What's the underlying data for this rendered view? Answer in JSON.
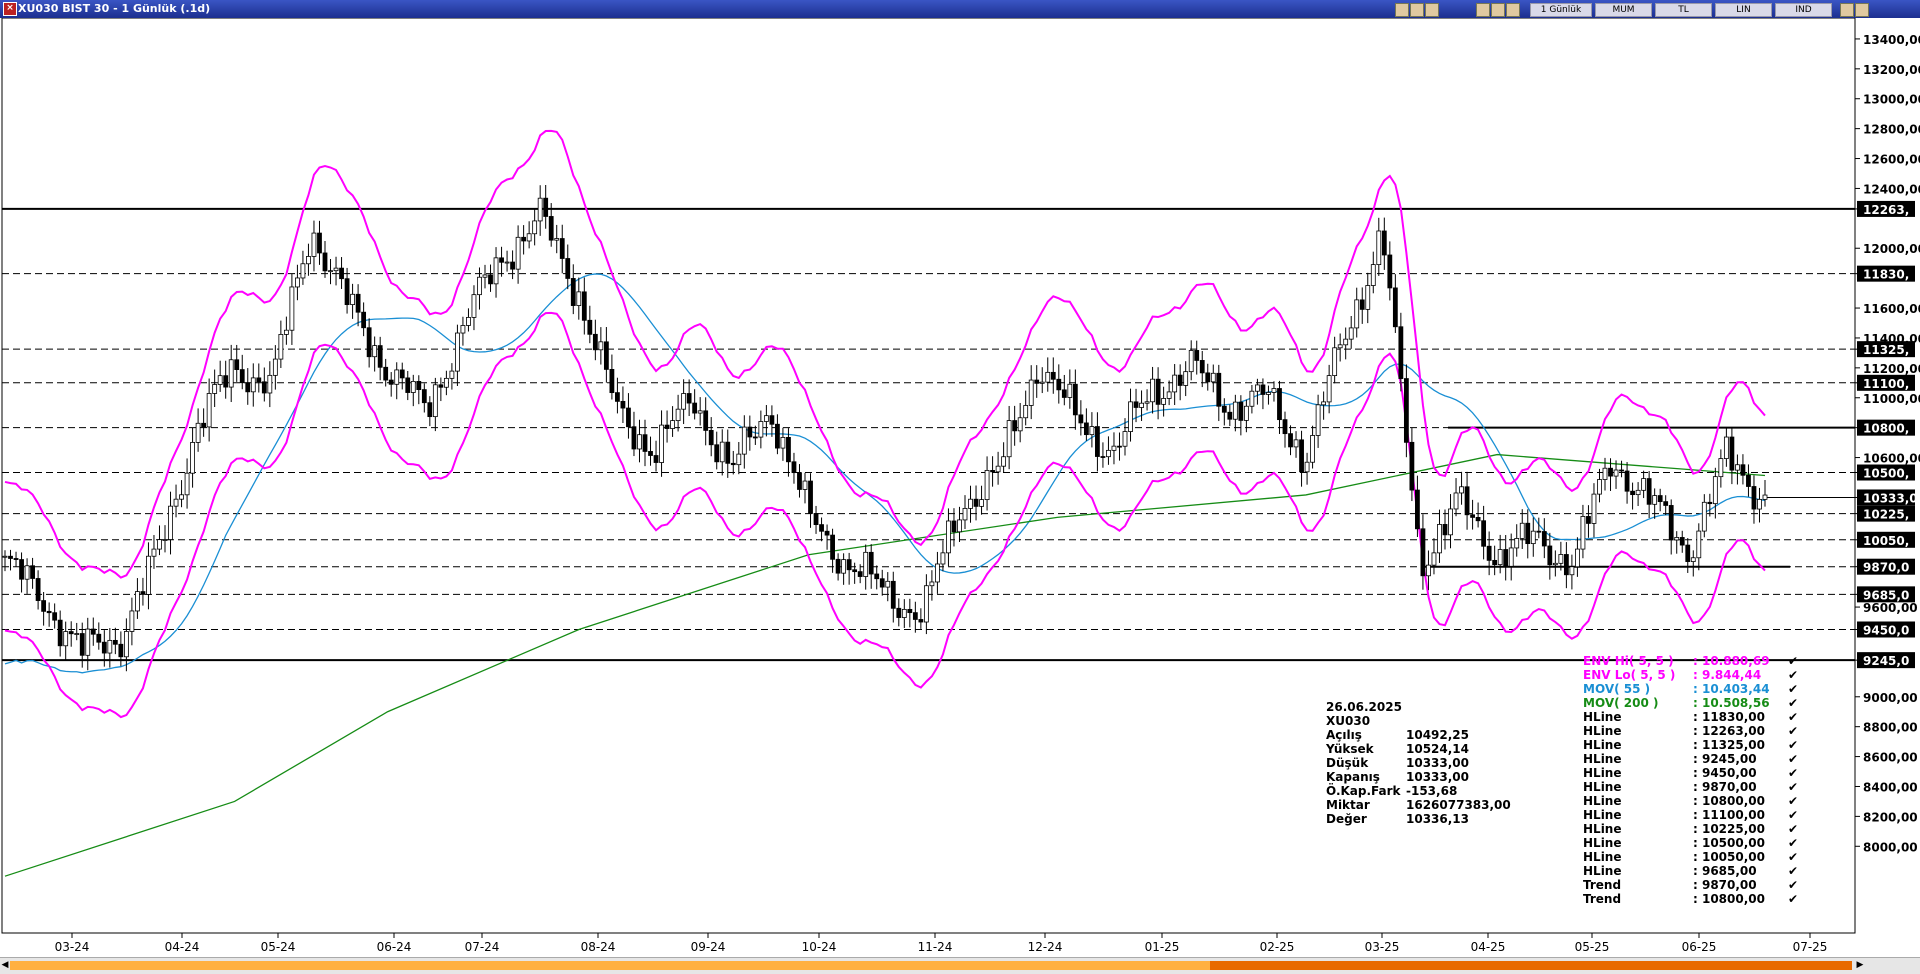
{
  "window": {
    "title": "XU030 BIST 30 - 1 Günlük (.1d)",
    "toolbar": [
      "1 Günlük",
      "MUM",
      "TL",
      "LIN",
      "IND"
    ]
  },
  "chart_data": {
    "type": "candlestick",
    "symbol": "XU030",
    "ylim": [
      7420,
      13540
    ],
    "y_ticks": [
      8000,
      8200,
      8400,
      8600,
      8800,
      9000,
      9245,
      9450,
      9600,
      9685,
      9870,
      10050,
      10225,
      10333,
      10500,
      10600,
      10800,
      11000,
      11100,
      11200,
      11325,
      11400,
      11600,
      11830,
      12000,
      12263,
      12400,
      12600,
      12800,
      13000,
      13200,
      13400
    ],
    "y_tick_labels": [
      "8000,00",
      "8200,00",
      "8400,00",
      "8600,00",
      "8800,00",
      "9000,00",
      "9245,0",
      "9450,0",
      "9600,00",
      "9685,0",
      "9870,0",
      "10050,",
      "10225,",
      "10333,0",
      "10500,",
      "10600,00",
      "10800,",
      "11000,00",
      "11100,",
      "11200,00",
      "11325,",
      "11400,00",
      "11600,00",
      "11830,",
      "12000,00",
      "12263,",
      "12400,00",
      "12600,00",
      "12800,00",
      "13000,00",
      "13200,00",
      "13400,00"
    ],
    "x_labels": [
      "03-24",
      "04-24",
      "05-24",
      "06-24",
      "07-24",
      "08-24",
      "09-24",
      "10-24",
      "11-24",
      "12-24",
      "01-25",
      "02-25",
      "03-25",
      "04-25",
      "05-25",
      "06-25",
      "07-25"
    ],
    "last_price": 10333,
    "hlines_solid": [
      12263,
      9245
    ],
    "hlines_dashed": [
      11830,
      11325,
      11100,
      10800,
      10500,
      10225,
      10050,
      9870,
      9685,
      9450
    ],
    "trend_lines": [
      {
        "value": 10800,
        "from": "04-25",
        "to": "07-25"
      },
      {
        "value": 9870,
        "from": "03-25",
        "to": "07-25"
      }
    ],
    "close_path": [
      [
        "03-24",
        9900
      ],
      [
        "03-24b",
        9650
      ],
      [
        "03-24c",
        9300
      ],
      [
        "04-24",
        9400
      ],
      [
        "04-24b",
        9950
      ],
      [
        "05-24",
        10800
      ],
      [
        "05-24b",
        11200
      ],
      [
        "05-24c",
        11100
      ],
      [
        "06-24",
        12150
      ],
      [
        "06-24b",
        11600
      ],
      [
        "06-24c",
        11200
      ],
      [
        "07-24",
        10900
      ],
      [
        "07-24b",
        11500
      ],
      [
        "07-24c",
        11950
      ],
      [
        "08-24",
        12200
      ],
      [
        "08-24b",
        11700
      ],
      [
        "08-24c",
        10900
      ],
      [
        "09-24",
        10650
      ],
      [
        "09-24b",
        11000
      ],
      [
        "09-24c",
        10500
      ],
      [
        "10-24",
        10950
      ],
      [
        "10-24b",
        10200
      ],
      [
        "10-24c",
        9900
      ],
      [
        "11-24",
        9700
      ],
      [
        "11-24b",
        9550
      ],
      [
        "12-24",
        10300
      ],
      [
        "12-24b",
        10500
      ],
      [
        "12-24c",
        11250
      ],
      [
        "01-25",
        10850
      ],
      [
        "01-25b",
        10650
      ],
      [
        "01-25c",
        11050
      ],
      [
        "02-25",
        11200
      ],
      [
        "02-25b",
        10950
      ],
      [
        "02-25c",
        11000
      ],
      [
        "03-25",
        10600
      ],
      [
        "03-25b",
        11400
      ],
      [
        "03-25c",
        12100
      ],
      [
        "03-25d",
        9900
      ],
      [
        "04-25",
        10300
      ],
      [
        "04-25b",
        9950
      ],
      [
        "05-25",
        10050
      ],
      [
        "05-25b",
        9900
      ],
      [
        "05-25c",
        10600
      ],
      [
        "06-25",
        10300
      ],
      [
        "06-25b",
        9980
      ],
      [
        "06-25c",
        10600
      ],
      [
        "06-25d",
        10333
      ]
    ],
    "mov200_path": [
      [
        7800,
        0
      ],
      [
        8300,
        0.12
      ],
      [
        8900,
        0.2
      ],
      [
        9450,
        0.3
      ],
      [
        9950,
        0.42
      ],
      [
        10200,
        0.55
      ],
      [
        10350,
        0.68
      ],
      [
        10620,
        0.78
      ],
      [
        10520,
        0.88
      ],
      [
        10480,
        0.92
      ]
    ],
    "info": {
      "date": "26.06.2025",
      "symbol": "XU030",
      "rows": [
        {
          "k": "Açılış",
          "v": "10492,25"
        },
        {
          "k": "Yüksek",
          "v": "10524,14"
        },
        {
          "k": "Düşük",
          "v": "10333,00"
        },
        {
          "k": "Kapanış",
          "v": "10333,00"
        },
        {
          "k": "Ö.Kap.Fark",
          "v": "-153,68"
        },
        {
          "k": "Miktar",
          "v": "1626077383,00"
        },
        {
          "k": "Değer",
          "v": "10336,13"
        }
      ]
    },
    "legend": [
      {
        "name": "ENV Hi( 5, 5 )",
        "value": ": 10.880,69",
        "color": "#ff00ff"
      },
      {
        "name": "ENV Lo( 5, 5 )",
        "value": ": 9.844,44",
        "color": "#ff00ff"
      },
      {
        "name": "MOV( 55 )",
        "value": ": 10.403,44",
        "color": "#1a8fd4"
      },
      {
        "name": "MOV( 200 )",
        "value": ": 10.508,56",
        "color": "#168c16"
      },
      {
        "name": "HLine",
        "value": ": 11830,00",
        "color": "#000000"
      },
      {
        "name": "HLine",
        "value": ": 12263,00",
        "color": "#000000"
      },
      {
        "name": "HLine",
        "value": ": 11325,00",
        "color": "#000000"
      },
      {
        "name": "HLine",
        "value": ": 9245,00",
        "color": "#000000"
      },
      {
        "name": "HLine",
        "value": ": 9450,00",
        "color": "#000000"
      },
      {
        "name": "HLine",
        "value": ": 9870,00",
        "color": "#000000"
      },
      {
        "name": "HLine",
        "value": ": 10800,00",
        "color": "#000000"
      },
      {
        "name": "HLine",
        "value": ": 11100,00",
        "color": "#000000"
      },
      {
        "name": "HLine",
        "value": ": 10225,00",
        "color": "#000000"
      },
      {
        "name": "HLine",
        "value": ": 10500,00",
        "color": "#000000"
      },
      {
        "name": "HLine",
        "value": ": 10050,00",
        "color": "#000000"
      },
      {
        "name": "HLine",
        "value": ": 9685,00",
        "color": "#000000"
      },
      {
        "name": "Trend",
        "value": ": 9870,00",
        "color": "#000000"
      },
      {
        "name": "Trend",
        "value": ": 10800,00",
        "color": "#000000"
      }
    ],
    "colors": {
      "envelope": "#ff00ff",
      "mov55": "#1a8fd4",
      "mov200": "#168c16",
      "candle": "#000000"
    }
  }
}
